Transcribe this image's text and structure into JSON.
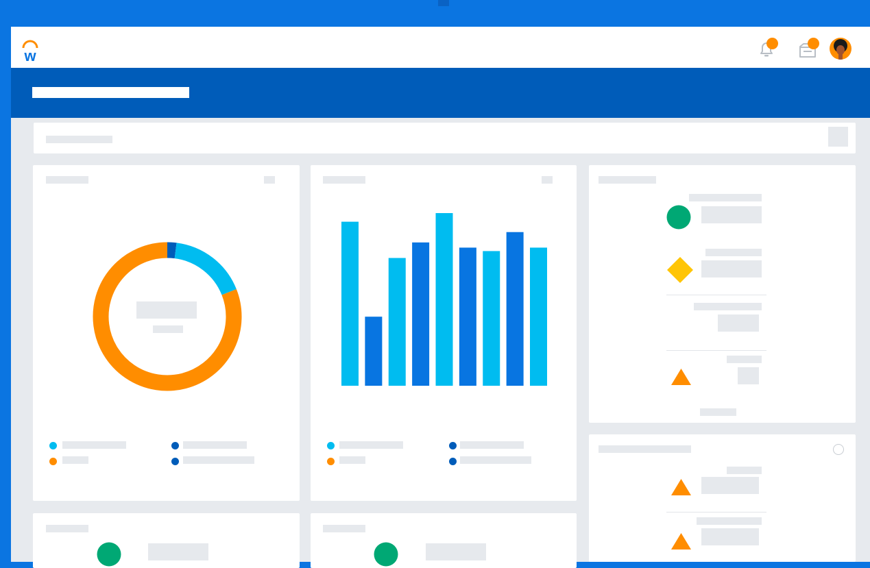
{
  "app": {
    "name": "Workday",
    "logo_letter": "w"
  },
  "colors": {
    "brand_blue": "#0b75e1",
    "header_blue": "#005cb9",
    "orange": "#ff8d00",
    "light_blue": "#00bcf0",
    "mid_blue": "#0875e1",
    "dark_blue": "#005cb9",
    "green": "#00a874",
    "yellow": "#ffc506",
    "placeholder": "#e6e9ed"
  },
  "header": {
    "notification_icon": "bell-icon",
    "inbox_icon": "inbox-icon",
    "avatar": "user-avatar"
  },
  "cards": {
    "donut_card": {
      "icon": "donut-chart"
    },
    "bar_card": {
      "icon": "bar-chart"
    },
    "status_card": {
      "status_icons": [
        "green-circle-icon",
        "yellow-diamond-icon",
        "orange-triangle-icon"
      ]
    },
    "alerts_card": {
      "status_icons": [
        "orange-triangle-icon",
        "orange-triangle-icon"
      ],
      "action_icon": "circle-icon"
    }
  },
  "chart_data": [
    {
      "type": "pie",
      "values": [
        2,
        17,
        81
      ],
      "colors": [
        "#005cb9",
        "#00bcf0",
        "#ff8d00"
      ]
    },
    {
      "type": "bar",
      "values": [
        95,
        40,
        74,
        83,
        100,
        80,
        78,
        89,
        80
      ],
      "colors": [
        "#00bcf0",
        "#0875e1",
        "#00bcf0",
        "#0875e1",
        "#00bcf0",
        "#0875e1",
        "#00bcf0",
        "#0875e1",
        "#00bcf0"
      ],
      "ylim": [
        0,
        100
      ]
    }
  ]
}
